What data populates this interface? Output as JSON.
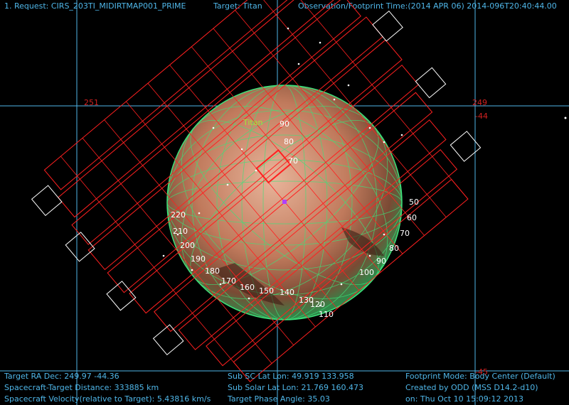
{
  "header": {
    "request": "1. Request: CIRS_203TI_MIDIRTMAP001_PRIME",
    "target": "Target: Titan",
    "time": "Observation/Footprint Time:(2014 APR 06) 2014-096T20:40:44.00"
  },
  "grid_labels": {
    "ra_left": "251",
    "ra_right": "249",
    "dec_top": "-44",
    "dec_bottom": "-45"
  },
  "body_label": "Titan",
  "longitude_labels": [
    "90",
    "80",
    "70",
    "60",
    "50",
    "60",
    "70",
    "80",
    "90",
    "100",
    "220",
    "210",
    "200",
    "190",
    "180",
    "170",
    "160",
    "150",
    "140",
    "130",
    "120",
    "110"
  ],
  "footer": {
    "left": [
      "Target RA Dec: 249.97  -44.36",
      "Spacecraft-Target Distance:  333885 km",
      "Spacecraft Velocity(relative to Target): 5.43816 km/s"
    ],
    "middle": [
      "Sub SC Lat Lon: 49.919  133.958",
      "Sub Solar Lat Lon: 21.769  160.473",
      "Target Phase Angle: 35.03"
    ],
    "right": [
      "Footprint Mode: Body Center (Default)",
      "Created by ODD (MSS D14.2-d10)",
      "on: Thu Oct 10 15:09:12 2013"
    ]
  },
  "colors": {
    "grid": "#4fb6e8",
    "footprint": "#ff2020",
    "planet_mesh": "#3de27a",
    "background": "#000000"
  }
}
